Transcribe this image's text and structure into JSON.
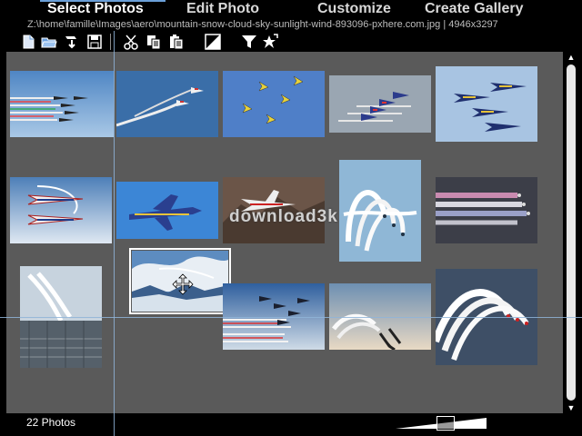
{
  "tabs": [
    {
      "label": "Select Photos",
      "active": true
    },
    {
      "label": "Edit Photo",
      "active": false
    },
    {
      "label": "Customize",
      "active": false
    },
    {
      "label": "Create Gallery",
      "active": false
    }
  ],
  "file_info": "Z:\\home\\famille\\Images\\aero\\mountain-snow-cloud-sky-sunlight-wind-893096-pxhere.com.jpg | 4946x3297",
  "toolbar_icons": [
    "new-file-icon",
    "open-folder-icon",
    "import-icon",
    "save-icon",
    "cut-icon",
    "copy-icon",
    "paste-icon",
    "contrast-icon",
    "filter-icon",
    "star-icon"
  ],
  "status": {
    "photo_count": "22 Photos"
  },
  "watermark_text": "download3k",
  "colors": {
    "accent": "#6a9fd8",
    "grid_bg": "#5a5a5a",
    "frame_bg": "#000000",
    "guide_line": "#8fb4d8"
  }
}
